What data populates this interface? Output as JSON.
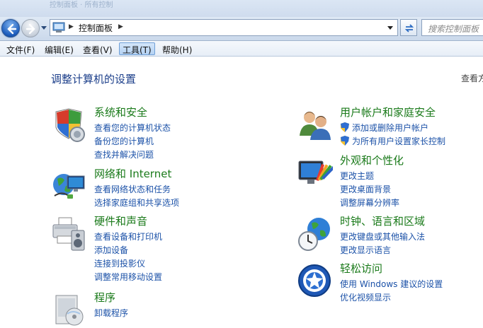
{
  "window": {
    "title_ghost": "控制面板 · 所有控制"
  },
  "address": {
    "crumb": "控制面板",
    "search_placeholder": "搜索控制面板"
  },
  "menu": [
    {
      "label": "文件(F)"
    },
    {
      "label": "编辑(E)"
    },
    {
      "label": "查看(V)"
    },
    {
      "label": "工具(T)"
    },
    {
      "label": "帮助(H)"
    }
  ],
  "page": {
    "title": "调整计算机的设置",
    "view_by": "查看方"
  },
  "categories": {
    "system": {
      "title": "系统和安全",
      "links": [
        "查看您的计算机状态",
        "备份您的计算机",
        "查找并解决问题"
      ]
    },
    "network": {
      "title": "网络和 Internet",
      "links": [
        "查看网络状态和任务",
        "选择家庭组和共享选项"
      ]
    },
    "hardware": {
      "title": "硬件和声音",
      "links": [
        "查看设备和打印机",
        "添加设备",
        "连接到投影仪",
        "调整常用移动设置"
      ]
    },
    "programs": {
      "title": "程序",
      "links": [
        "卸载程序"
      ]
    },
    "users": {
      "title": "用户帐户和家庭安全",
      "links": [
        "添加或删除用户帐户",
        "为所有用户设置家长控制"
      ]
    },
    "appearance": {
      "title": "外观和个性化",
      "links": [
        "更改主题",
        "更改桌面背景",
        "调整屏幕分辨率"
      ]
    },
    "clock": {
      "title": "时钟、语言和区域",
      "links": [
        "更改键盘或其他输入法",
        "更改显示语言"
      ]
    },
    "ease": {
      "title": "轻松访问",
      "links": [
        "使用 Windows 建议的设置",
        "优化视频显示"
      ]
    }
  }
}
